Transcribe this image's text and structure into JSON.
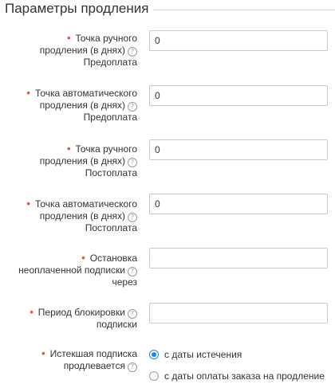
{
  "section": {
    "title": "Параметры продления"
  },
  "fields": [
    {
      "lines": [
        "Точка ручного",
        "продления (в днях)",
        "Предоплата"
      ],
      "value": "0"
    },
    {
      "lines": [
        "Точка автоматического",
        "продления (в днях)",
        "Предоплата"
      ],
      "value": "0"
    },
    {
      "lines": [
        "Точка ручного",
        "продления (в днях)",
        "Постоплата"
      ],
      "value": "0"
    },
    {
      "lines": [
        "Точка автоматического",
        "продления (в днях)",
        "Постоплата"
      ],
      "value": "0"
    },
    {
      "lines": [
        "Остановка",
        "неоплаченной подписки",
        "через"
      ],
      "value": ""
    },
    {
      "lines": [
        "Период блокировки",
        "подписки"
      ],
      "value": ""
    }
  ],
  "expired": {
    "lines": [
      "Истекшая подписка",
      "продлевается"
    ],
    "options": [
      "с даты истечения",
      "с даты оплаты заказа на продление"
    ],
    "selected_index": 0
  },
  "help_icon": "question-circle-icon",
  "colors": {
    "required": "#e8553d",
    "radio_selected": "#1e88e5"
  }
}
